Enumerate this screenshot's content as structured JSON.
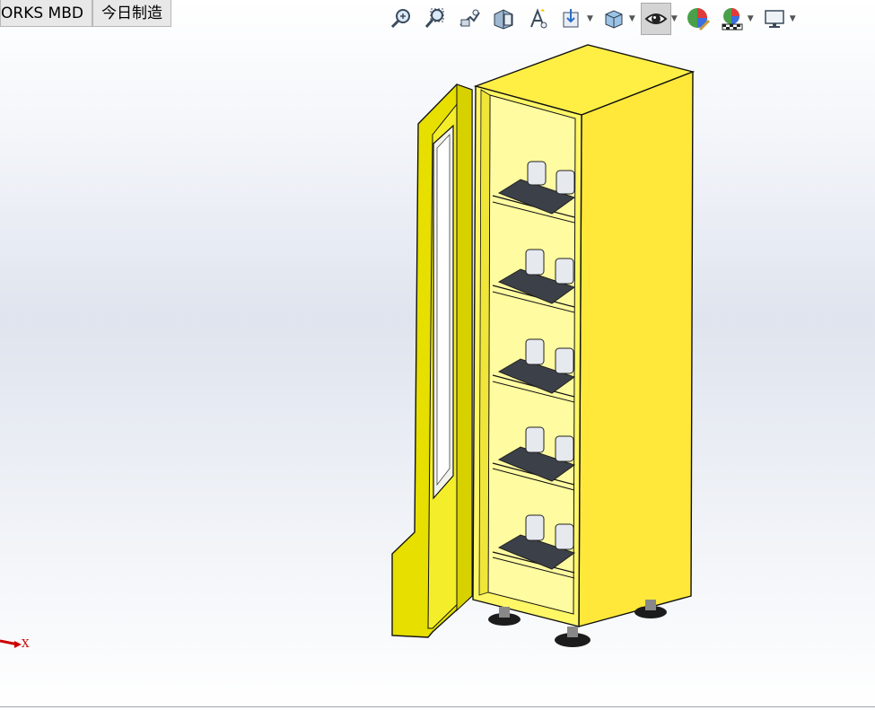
{
  "tabs": [
    {
      "label": "ORKS MBD"
    },
    {
      "label": "今日制造"
    }
  ],
  "toolbar": {
    "buttons": [
      {
        "icon": "zoom-to-fit-icon",
        "dropdown": false
      },
      {
        "icon": "zoom-to-area-icon",
        "dropdown": false
      },
      {
        "icon": "previous-view-icon",
        "dropdown": false
      },
      {
        "icon": "section-view-icon",
        "dropdown": false
      },
      {
        "icon": "dynamic-annotation-icon",
        "dropdown": false
      },
      {
        "icon": "view-orientation-icon",
        "dropdown": true
      },
      {
        "icon": "display-style-icon",
        "dropdown": true
      },
      {
        "icon": "hide-show-items-icon",
        "dropdown": true,
        "active": true
      },
      {
        "icon": "edit-appearance-icon",
        "dropdown": false
      },
      {
        "icon": "apply-scene-icon",
        "dropdown": true
      },
      {
        "icon": "view-settings-icon",
        "dropdown": true
      }
    ]
  },
  "model": {
    "body_color": "#ffef44",
    "door_color": "#e8e000",
    "shelf_count": 5
  },
  "triad": {
    "x_label": "X",
    "x_color": "#cc0000"
  }
}
